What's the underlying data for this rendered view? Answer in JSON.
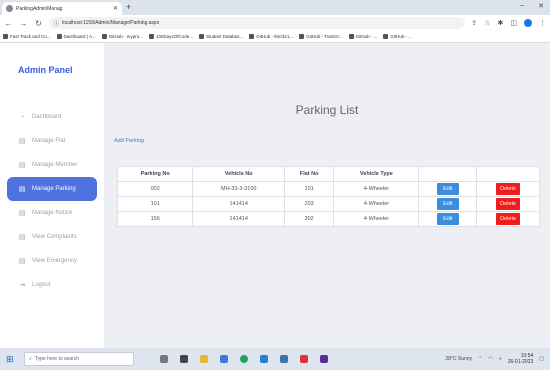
{
  "browser": {
    "tab_title": "ParkingAdminManag",
    "url": "localhost:1159/Admin/Manage/Parking.aspx",
    "bookmarks": [
      "Fast Track and Co...",
      "Dashboard | A...",
      "GitHub - mypro...",
      "100DaysOfCode...",
      "Student Databas...",
      "GitHub - the/321...",
      "GitHub - TrainGr...",
      "GitHub - ...",
      "GitHub - ..."
    ]
  },
  "sidebar": {
    "brand": "Admin Panel",
    "items": [
      {
        "label": "Dashboard",
        "icon": "dashboard-icon",
        "active": false
      },
      {
        "label": "Manage Flat",
        "icon": "flat-icon",
        "active": false
      },
      {
        "label": "Manage Member",
        "icon": "member-icon",
        "active": false
      },
      {
        "label": "Manage Parking",
        "icon": "parking-icon",
        "active": true
      },
      {
        "label": "Manage Notice",
        "icon": "notice-icon",
        "active": false
      },
      {
        "label": "View Complaints",
        "icon": "complaint-icon",
        "active": false
      },
      {
        "label": "View Emergency",
        "icon": "emergency-icon",
        "active": false
      },
      {
        "label": "Logout",
        "icon": "logout-icon",
        "active": false
      }
    ]
  },
  "main": {
    "title": "Parking List",
    "add_link": "Add Parking",
    "table": {
      "headers": [
        "Parking No",
        "Vehicle No",
        "Flat No",
        "Vehicle Type",
        "",
        ""
      ],
      "rows": [
        [
          "002",
          "MH-33-3-3100",
          "101",
          "4-Wheeler"
        ],
        [
          "101",
          "141414",
          "203",
          "4-Wheeler"
        ],
        [
          "156",
          "141414",
          "302",
          "4-Wheeler"
        ]
      ],
      "edit_label": "Edit",
      "delete_label": "Delete"
    }
  },
  "taskbar": {
    "search_placeholder": "Type here to search",
    "time": "10:54",
    "date": "26-01-2023",
    "weather": "28°C Sunny"
  },
  "colors": {
    "accent": "#4e73df",
    "edit": "#3c8dde",
    "delete": "#f11c1c"
  }
}
